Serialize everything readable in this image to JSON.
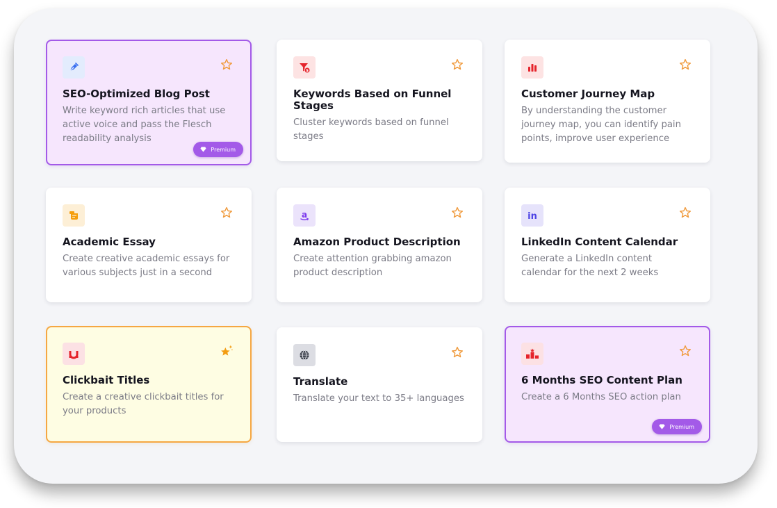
{
  "badge_label": "Premium",
  "colors": {
    "premium_accent": "#a35ae8",
    "premium_bg": "#f6e6fd",
    "hot_accent": "#f5a742",
    "hot_bg": "#fefde3",
    "star": "#f09a3c"
  },
  "cards": [
    {
      "title": "SEO-Optimized Blog Post",
      "description": "Write keyword rich articles that use active voice and pass the Flesch readability analysis",
      "icon": "pen-nib-icon",
      "variant": "premium",
      "premium": true
    },
    {
      "title": "Keywords Based on Funnel Stages",
      "description": "Cluster keywords based on funnel stages",
      "icon": "funnel-dollar-icon",
      "variant": "default",
      "premium": false
    },
    {
      "title": "Customer Journey Map",
      "description": "By understanding the customer journey map, you can identify pain points, improve user experience",
      "icon": "bar-chart-icon",
      "variant": "default",
      "premium": false
    },
    {
      "title": "Academic Essay",
      "description": "Create creative academic essays for various subjects just in a second",
      "icon": "scroll-icon",
      "variant": "default",
      "premium": false
    },
    {
      "title": "Amazon Product Description",
      "description": "Create attention grabbing amazon product description",
      "icon": "amazon-icon",
      "variant": "default",
      "premium": false
    },
    {
      "title": "LinkedIn Content Calendar",
      "description": "Generate a LinkedIn content calendar for the next 2 weeks",
      "icon": "linkedin-icon",
      "variant": "default",
      "premium": false
    },
    {
      "title": "Clickbait Titles",
      "description": "Create a creative clickbait titles for your products",
      "icon": "magnet-icon",
      "variant": "hot",
      "premium": false
    },
    {
      "title": "Translate",
      "description": "Translate your text to 35+ languages",
      "icon": "globe-icon",
      "variant": "default",
      "premium": false
    },
    {
      "title": "6 Months SEO Content Plan",
      "description": "Create a 6 Months SEO action plan",
      "icon": "podium-icon",
      "variant": "premium",
      "premium": true
    }
  ]
}
